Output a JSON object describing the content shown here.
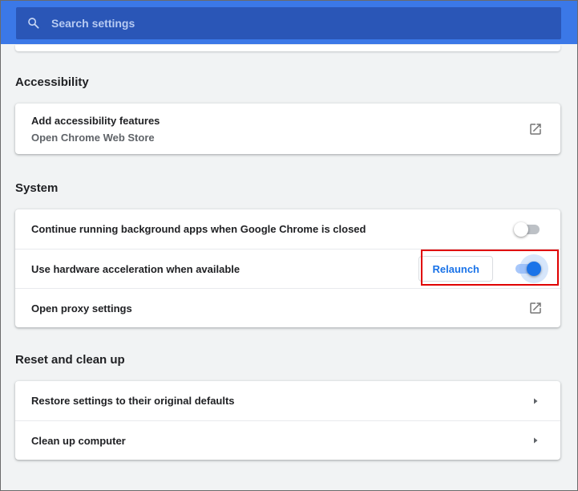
{
  "search": {
    "placeholder": "Search settings"
  },
  "accessibility": {
    "title": "Accessibility",
    "add_features_label": "Add accessibility features",
    "add_features_sub": "Open Chrome Web Store"
  },
  "system": {
    "title": "System",
    "background_apps_label": "Continue running background apps when Google Chrome is closed",
    "background_apps_on": false,
    "hw_accel_label": "Use hardware acceleration when available",
    "hw_accel_on": true,
    "relaunch_label": "Relaunch",
    "proxy_label": "Open proxy settings"
  },
  "reset": {
    "title": "Reset and clean up",
    "restore_label": "Restore settings to their original defaults",
    "cleanup_label": "Clean up computer"
  },
  "colors": {
    "header": "#3b78e7",
    "search_field": "#2a56b7",
    "accent": "#1a73e8",
    "highlight": "#e00000"
  },
  "icons": {
    "search": "search-icon",
    "external_link": "open-in-new-icon",
    "arrow": "arrow-right-icon"
  }
}
